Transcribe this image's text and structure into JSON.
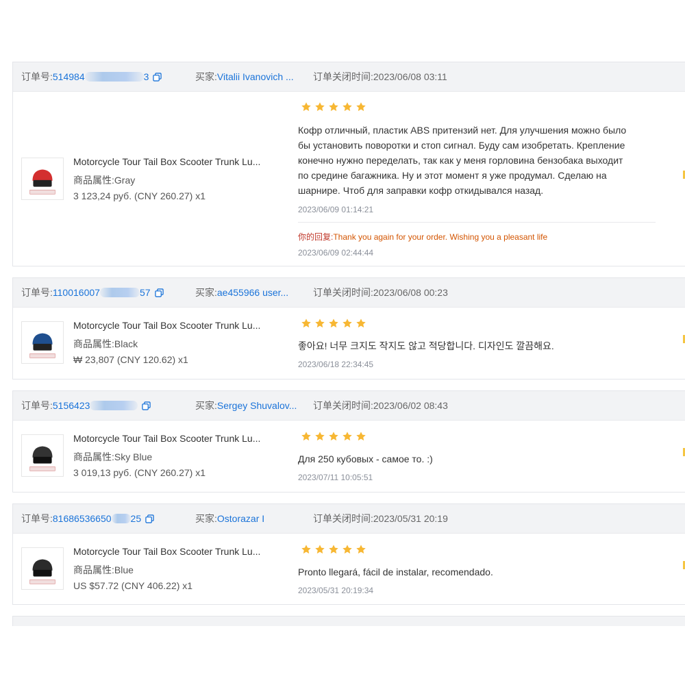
{
  "labels": {
    "order_no": "订单号:",
    "buyer": "买家:",
    "closed_time": "订单关闭时间:",
    "attr": "商品属性:",
    "reply": "你的回复:"
  },
  "colors": {
    "link": "#1a73d9",
    "star": "#f7b733",
    "reply_label": "#c0392b",
    "reply_text": "#d35400"
  },
  "orders": [
    {
      "order_no_start": "514984",
      "order_no_end": "3",
      "buyer": "Vitalii Ivanovich ...",
      "closed_time": "2023/06/08 03:11",
      "product_title": "Motorcycle Tour Tail Box Scooter Trunk Lu...",
      "attr": "Gray",
      "price": "3 123,24 руб.  (CNY  260.27)  x1",
      "rating": 5,
      "review_lines": [
        "Кофр отличный, пластик ABS притензий нет. Для улучшения можно было",
        "бы установить поворотки и стоп сигнал. Буду сам изобретать. Крепление",
        "конечно нужно переделать, так как у меня горловина бензобака выходит",
        "по средине багажника. Ну и этот момент я уже продумал. Сделаю на",
        "шарнире. Чтоб для заправки кофр откидывался назад."
      ],
      "review_date": "2023/06/09 01:14:21",
      "reply_text": "Thank you again for your order. Wishing you a pleasant life",
      "reply_date": "2023/06/09 02:44:44"
    },
    {
      "order_no_start": "110016007",
      "order_no_end": "57",
      "buyer": "ae455966 user...",
      "closed_time": "2023/06/08 00:23",
      "product_title": "Motorcycle Tour Tail Box Scooter Trunk Lu...",
      "attr": "Black",
      "price": "₩ 23,807  (CNY  120.62)  x1",
      "rating": 5,
      "review": "좋아요! 너무 크지도 작지도 않고 적당합니다. 디자인도 깔끔해요.",
      "review_date": "2023/06/18 22:34:45"
    },
    {
      "order_no_start": "5156423",
      "order_no_end": "",
      "buyer": "Sergey Shuvalov...",
      "closed_time": "2023/06/02 08:43",
      "product_title": "Motorcycle Tour Tail Box Scooter Trunk Lu...",
      "attr": "Sky Blue",
      "price": "3 019,13 руб.  (CNY  260.27)  x1",
      "rating": 5,
      "review": "Для 250 кубовых - самое то. :)",
      "review_date": "2023/07/11 10:05:51"
    },
    {
      "order_no_start": "81686536650",
      "order_no_end": "25",
      "buyer": "Ostorazar I",
      "closed_time": "2023/05/31 20:19",
      "product_title": "Motorcycle Tour Tail Box Scooter Trunk Lu...",
      "attr": "Blue",
      "price": "US $57.72  (CNY  406.22)  x1",
      "rating": 5,
      "review": "Pronto llegará, fácil de instalar, recomendado.",
      "review_date": "2023/05/31 20:19:34"
    }
  ]
}
